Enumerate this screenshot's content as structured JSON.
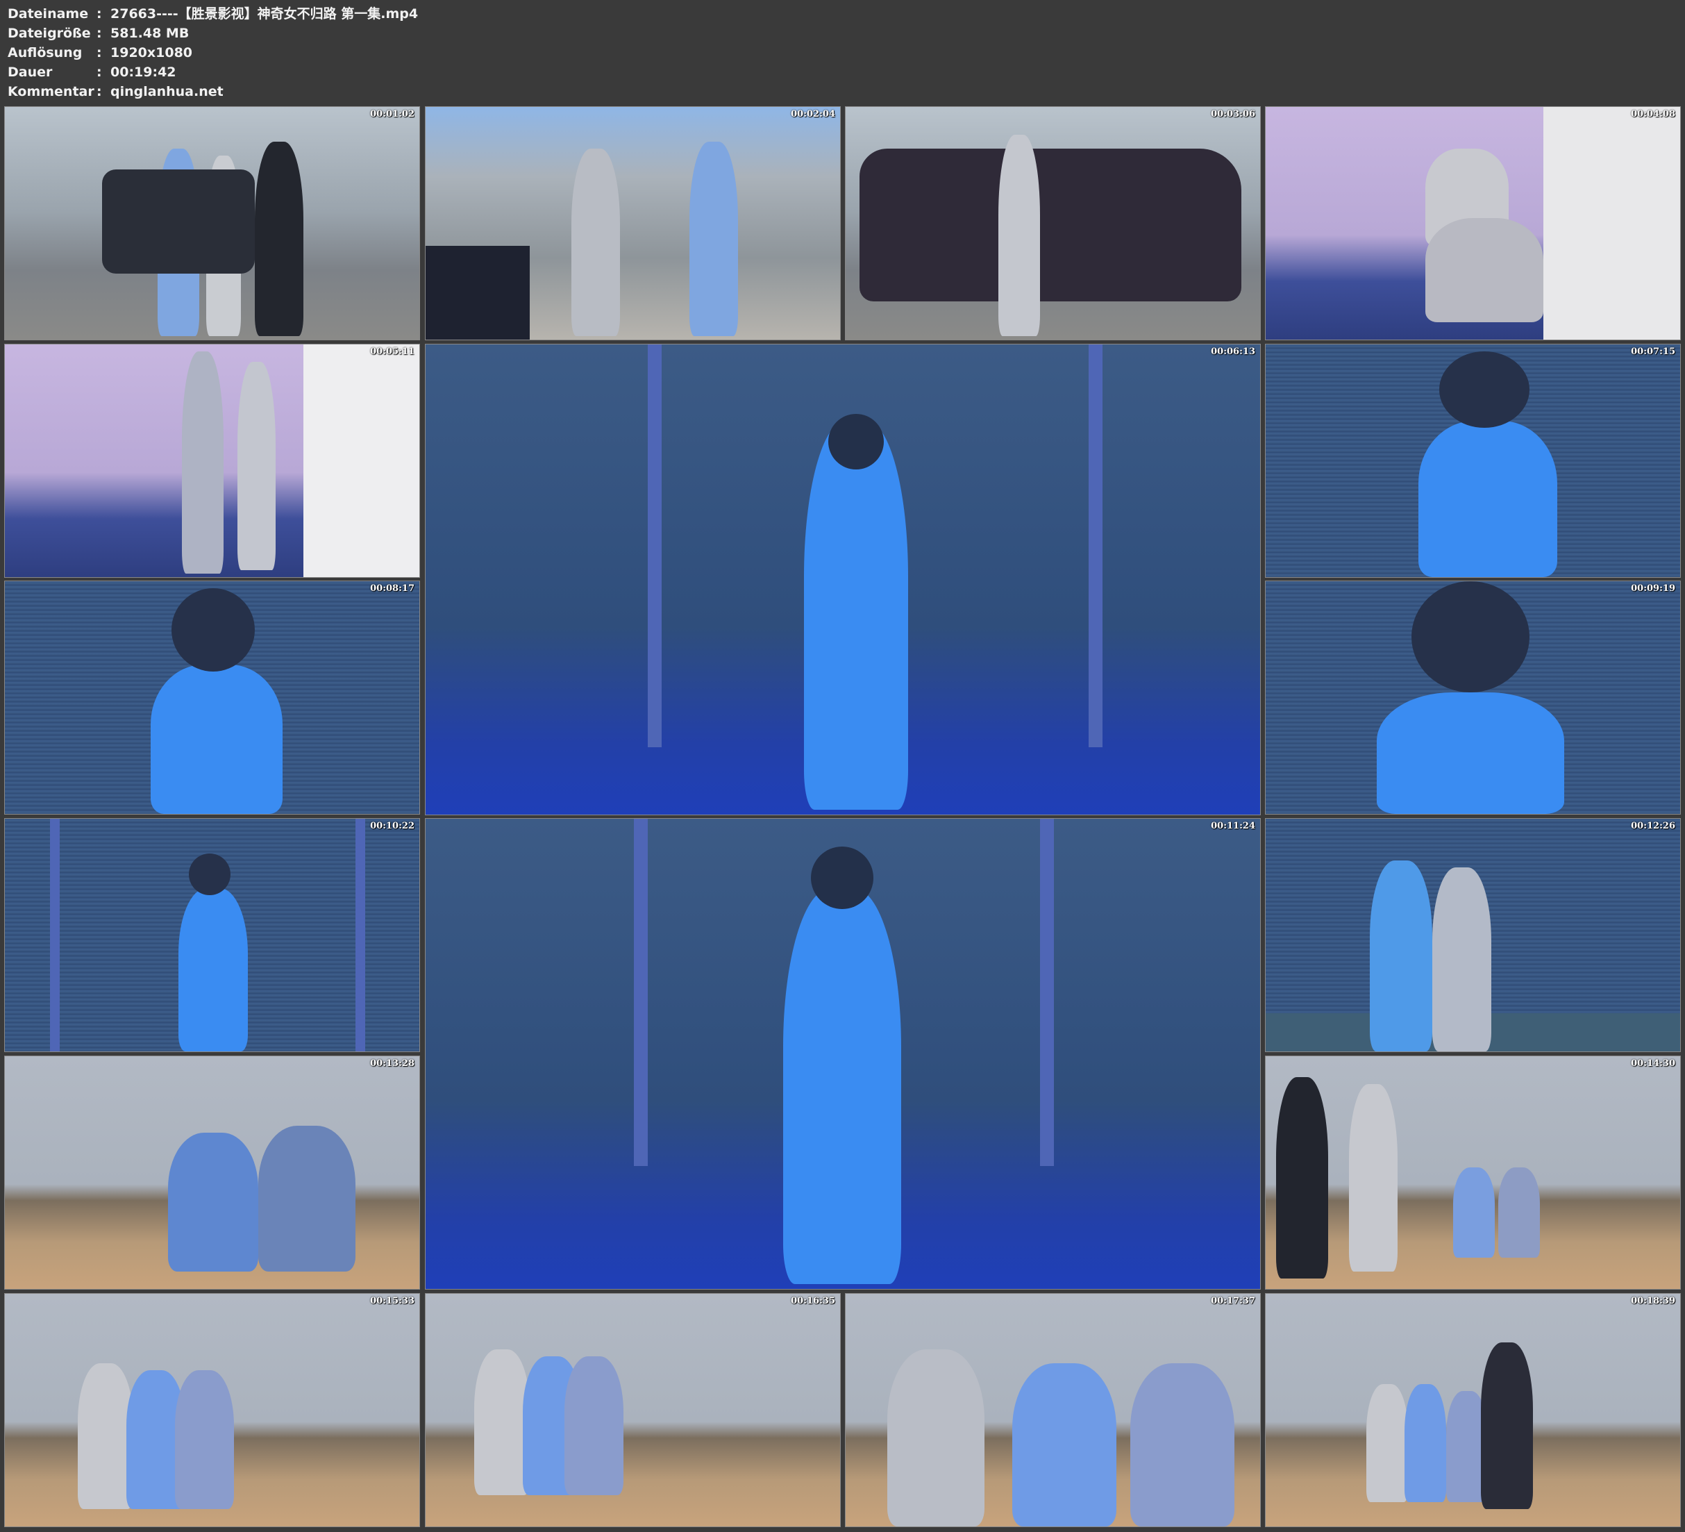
{
  "info": [
    {
      "key": "Dateiname",
      "value": "27663----【胜景影视】神奇女不归路 第一集.mp4"
    },
    {
      "key": "Dateigröße",
      "value": "581.48 MB"
    },
    {
      "key": "Auflösung",
      "value": "1920x1080"
    },
    {
      "key": "Dauer",
      "value": "00:19:42"
    },
    {
      "key": "Kommentar",
      "value": "qinglanhua.net"
    }
  ],
  "separator": ":",
  "thumbnails": [
    {
      "time": "00:01:02",
      "scene": "street"
    },
    {
      "time": "00:02:04",
      "scene": "street2"
    },
    {
      "time": "00:03:06",
      "scene": "street"
    },
    {
      "time": "00:04:08",
      "scene": "room"
    },
    {
      "time": "00:05:11",
      "scene": "room"
    },
    {
      "time": "00:06:13",
      "scene": "blue"
    },
    {
      "time": "00:07:15",
      "scene": "blue-s"
    },
    {
      "time": "00:08:17",
      "scene": "blue-s"
    },
    {
      "time": "00:09:19",
      "scene": "blue-s"
    },
    {
      "time": "00:10:22",
      "scene": "blue-s"
    },
    {
      "time": "00:11:24",
      "scene": "blue"
    },
    {
      "time": "00:12:26",
      "scene": "blue-s"
    },
    {
      "time": "00:13:28",
      "scene": "wall"
    },
    {
      "time": "00:14:30",
      "scene": "wall"
    },
    {
      "time": "00:15:33",
      "scene": "wall"
    },
    {
      "time": "00:16:35",
      "scene": "wall"
    },
    {
      "time": "00:17:37",
      "scene": "wall"
    },
    {
      "time": "00:18:39",
      "scene": "wall"
    }
  ]
}
